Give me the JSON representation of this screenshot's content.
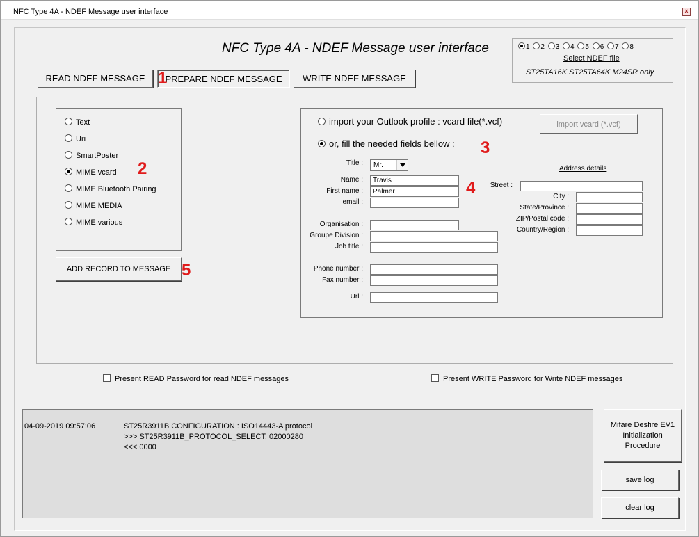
{
  "window": {
    "title": "NFC Type 4A - NDEF Message user interface",
    "close_glyph": "×"
  },
  "header": {
    "title": "NFC Type 4A - NDEF Message user interface"
  },
  "ndef_file": {
    "options": [
      "1",
      "2",
      "3",
      "4",
      "5",
      "6",
      "7",
      "8"
    ],
    "selected": "1",
    "select_label": "Select NDEF file",
    "note": "ST25TA16K ST25TA64K M24SR only"
  },
  "tabs": {
    "read": "READ NDEF MESSAGE",
    "prepare": "PREPARE NDEF MESSAGE",
    "write": "WRITE NDEF MESSAGE",
    "active": "prepare"
  },
  "markers": {
    "m1": "1",
    "m2": "2",
    "m3": "3",
    "m4": "4",
    "m5": "5",
    "color": "#e01b1b"
  },
  "record_types": {
    "items": [
      "Text",
      "Uri",
      "SmartPoster",
      "MIME vcard",
      "MIME Bluetooth Pairing",
      "MIME MEDIA",
      "MIME various"
    ],
    "selected": "MIME vcard"
  },
  "add_record_label": "ADD RECORD TO MESSAGE",
  "vcard": {
    "import_option": "import your Outlook profile : vcard file(*.vcf)",
    "fill_option": "or, fill the needed fields bellow :",
    "selected": "fill",
    "import_button": "import vcard (*.vcf)",
    "labels": {
      "title": "Title :",
      "name": "Name :",
      "first_name": "First name :",
      "email": "email :",
      "organisation": "Organisation :",
      "group_division": "Groupe Division :",
      "job_title": "Job title :",
      "phone": "Phone number :",
      "fax": "Fax number :",
      "url": "Url :",
      "street": "Street :",
      "city": "City :",
      "state": "State/Province :",
      "zip": "ZIP/Postal code :",
      "country": "Country/Region :"
    },
    "values": {
      "title": "Mr.",
      "name": "Travis",
      "first_name": "Palmer",
      "email": "",
      "organisation": "",
      "group_division": "",
      "job_title": "",
      "phone": "",
      "fax": "",
      "url": "",
      "street": "",
      "city": "",
      "state": "",
      "zip": "",
      "country": ""
    },
    "address_details": "Address details"
  },
  "passwords": {
    "read": "Present READ Password for read NDEF messages",
    "write": "Present WRITE Password for Write NDEF messages"
  },
  "log": {
    "timestamp": "04-09-2019 09:57:06",
    "lines": [
      "ST25R3911B CONFIGURATION : ISO14443-A protocol",
      ">>> ST25R3911B_PROTOCOL_SELECT, 02000280",
      "<<< 0000"
    ]
  },
  "side_buttons": {
    "mifare_line1": "Mifare Desfire EV1",
    "mifare_line2": "Initialization",
    "mifare_line3": "Procedure",
    "save_log": "save log",
    "clear_log": "clear log"
  }
}
